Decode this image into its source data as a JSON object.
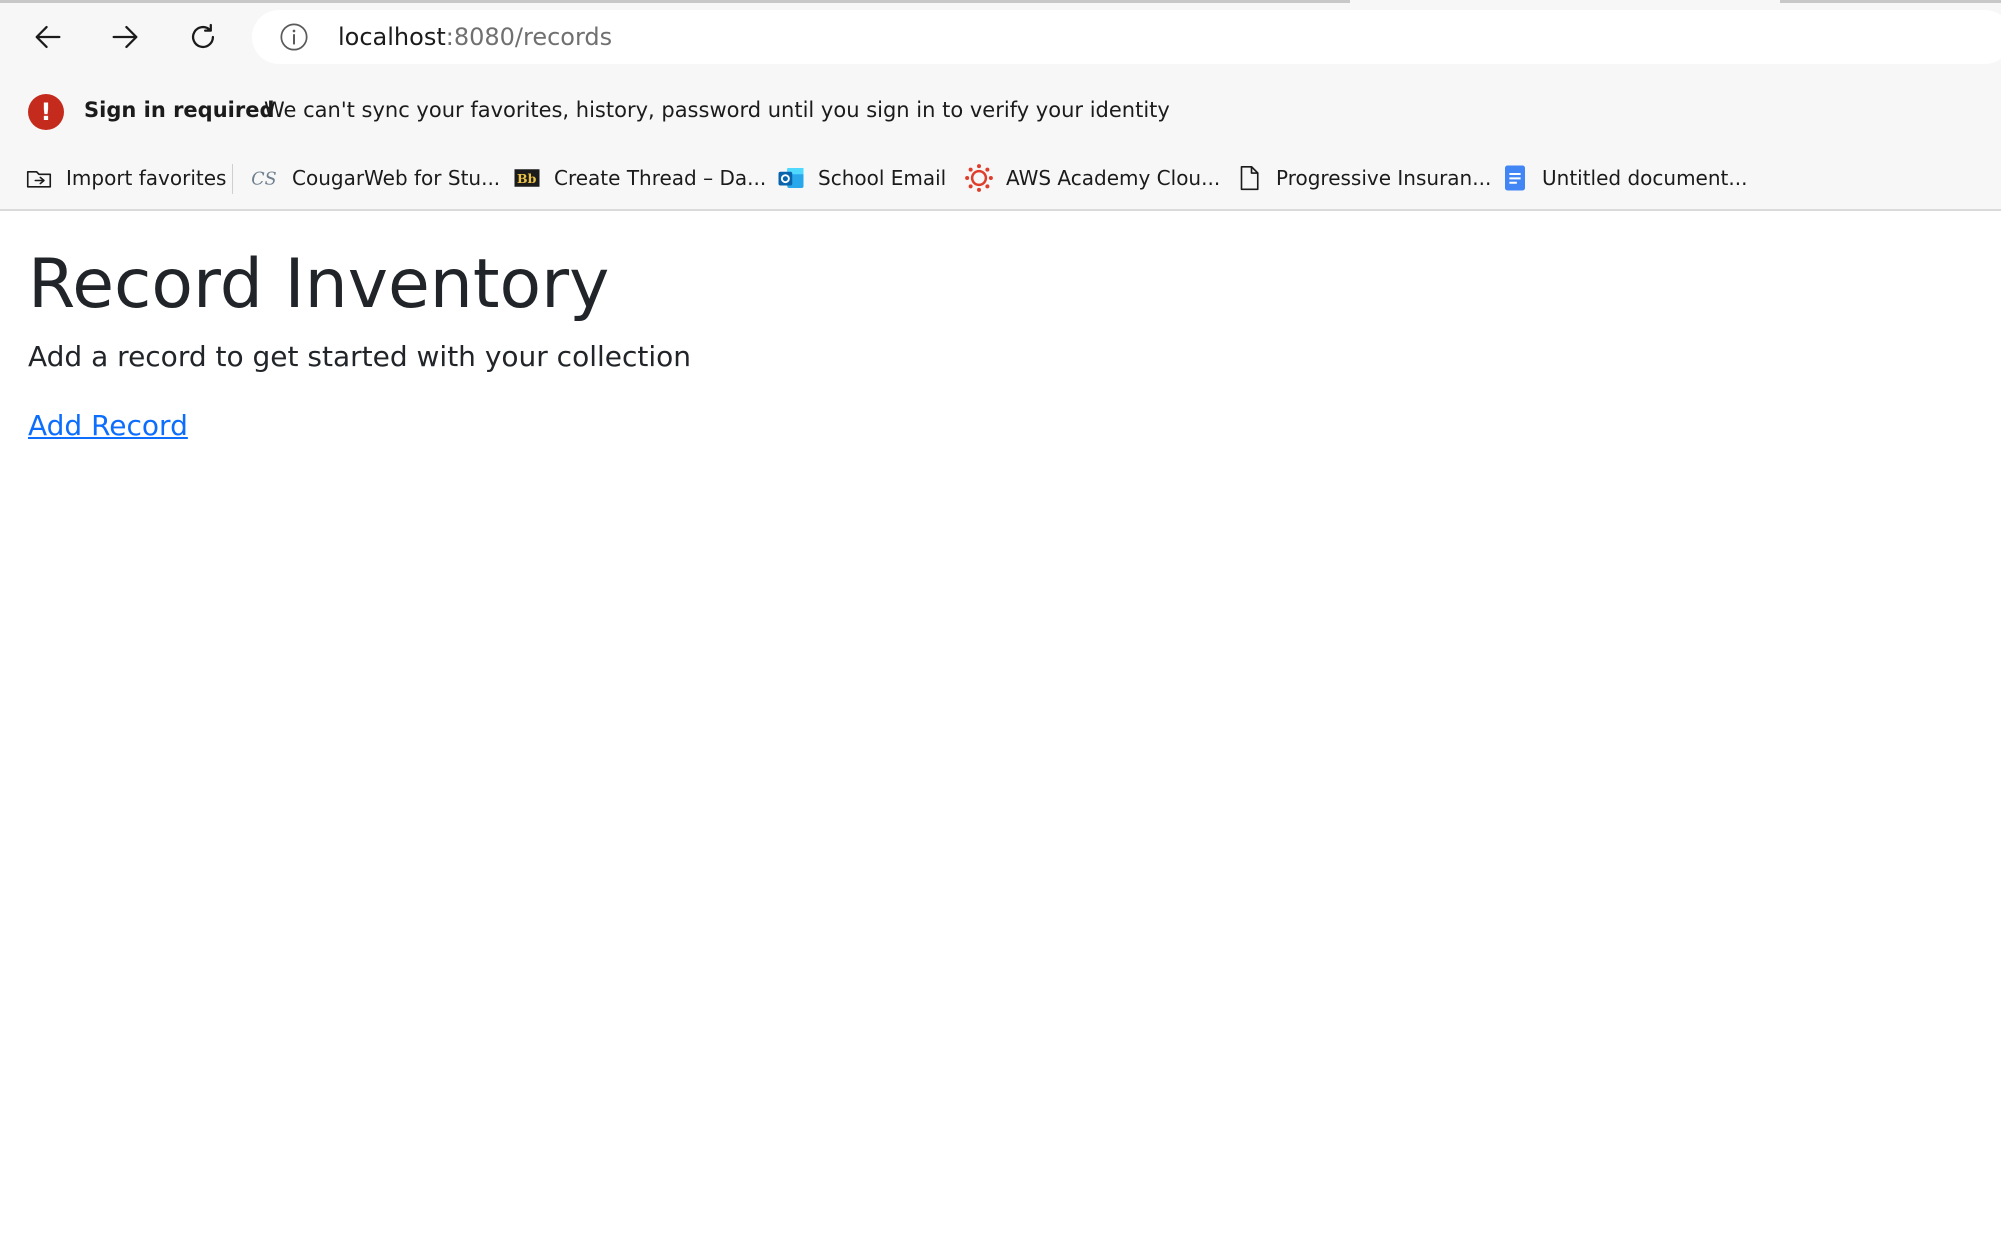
{
  "browser": {
    "address": {
      "host": "localhost",
      "path": ":8080/records"
    },
    "infobar": {
      "icon": "!",
      "title": "Sign in required",
      "message": "We can't sync your favorites, history, password until you sign in to verify your identity"
    },
    "favorites": [
      {
        "label": "Import favorites",
        "icon": "import-favorites-icon"
      },
      {
        "label": "CougarWeb for Stu...",
        "icon": "cs-logo-icon"
      },
      {
        "label": "Create Thread – Da...",
        "icon": "blackboard-icon"
      },
      {
        "label": "School Email",
        "icon": "outlook-icon"
      },
      {
        "label": "AWS Academy Clou...",
        "icon": "canvas-icon"
      },
      {
        "label": "Progressive Insuran...",
        "icon": "page-icon"
      },
      {
        "label": "Untitled document...",
        "icon": "google-docs-icon"
      }
    ]
  },
  "page": {
    "title": "Record Inventory",
    "subtitle": "Add a record to get started with your collection",
    "add_record_link": "Add Record"
  },
  "colors": {
    "link": "#0d6efd",
    "alert_red": "#c42b1c",
    "chrome_bg": "#f7f7f7"
  }
}
